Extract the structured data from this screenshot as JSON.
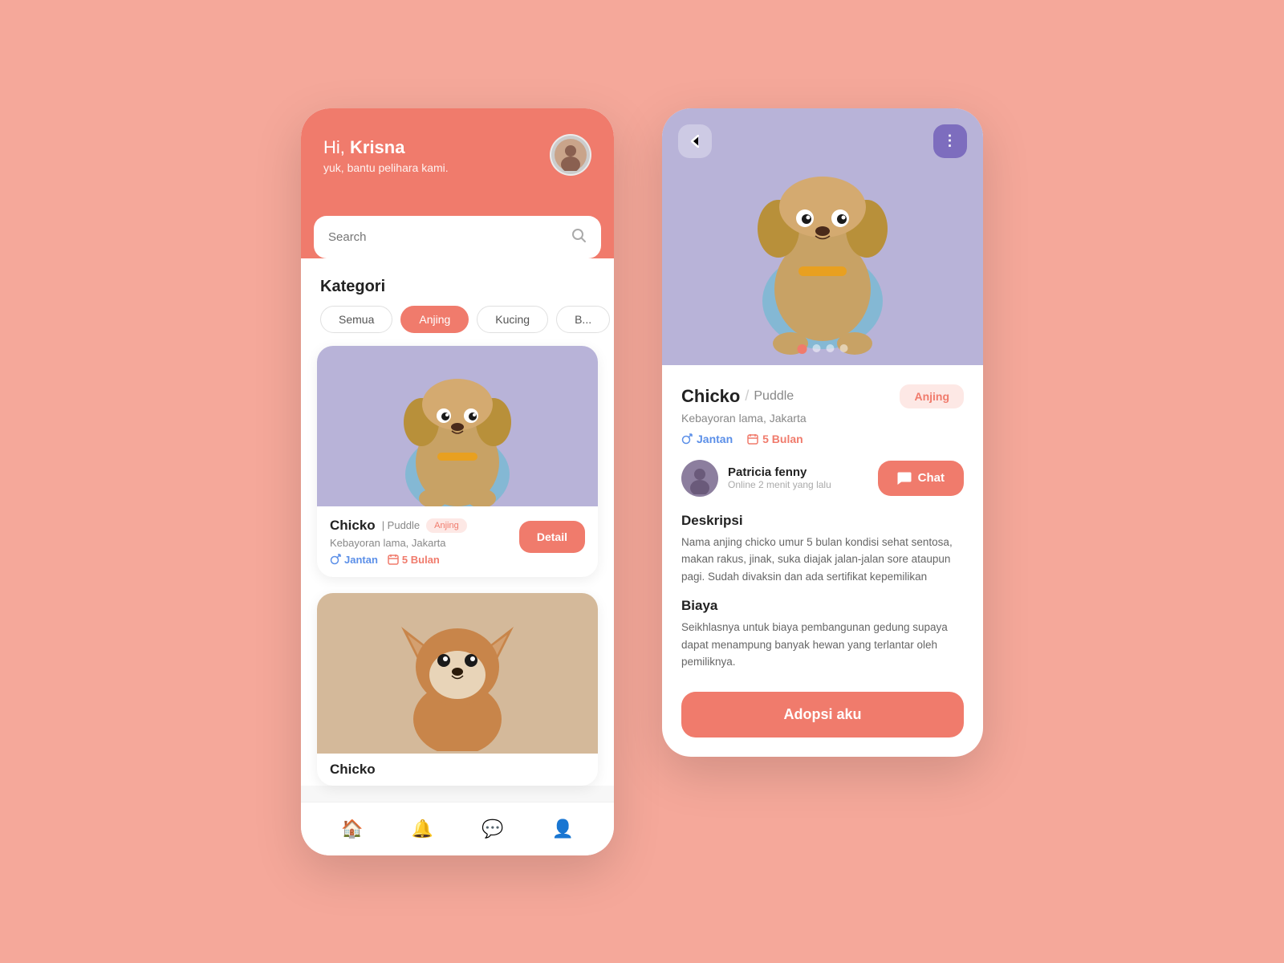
{
  "screen1": {
    "header": {
      "greeting": "Hi, ",
      "user_name": "Krisna",
      "subtitle": "yuk, bantu pelihara kami."
    },
    "search": {
      "placeholder": "Search"
    },
    "kategori": {
      "title": "Kategori",
      "tabs": [
        {
          "label": "Semua",
          "active": false
        },
        {
          "label": "Anjing",
          "active": true
        },
        {
          "label": "Kucing",
          "active": false
        },
        {
          "label": "B...",
          "active": false
        }
      ]
    },
    "pets": [
      {
        "name": "Chicko",
        "separator": "|",
        "breed": "Puddle",
        "badge": "Anjing",
        "location": "Kebayoran lama, Jakarta",
        "gender": "Jantan",
        "age": "5 Bulan",
        "detail_btn": "Detail"
      },
      {
        "name": "Chicko",
        "location": "..."
      }
    ]
  },
  "screen2": {
    "back_btn": "‹",
    "more_btn": "⋮",
    "pet": {
      "name": "Chicko",
      "breed": "Puddle",
      "badge": "Anjing",
      "location": "Kebayoran lama, Jakarta",
      "gender": "Jantan",
      "age": "5 Bulan"
    },
    "owner": {
      "name": "Patricia fenny",
      "status": "Online 2 menit yang lalu"
    },
    "chat_btn": "Chat",
    "deskripsi": {
      "title": "Deskripsi",
      "text": "Nama anjing chicko umur 5 bulan kondisi sehat sentosa, makan rakus, jinak, suka diajak jalan-jalan sore ataupun pagi. Sudah divaksin dan ada sertifikat kepemilikan"
    },
    "biaya": {
      "title": "Biaya",
      "text": "Seikhlasnya untuk biaya pembangunan gedung supaya dapat menampung banyak hewan yang terlantar oleh pemiliknya."
    },
    "adopt_btn": "Adopsi aku"
  },
  "nav": {
    "items": [
      {
        "icon": "🏠",
        "label": "home",
        "active": true
      },
      {
        "icon": "🔔",
        "label": "notifications",
        "active": false
      },
      {
        "icon": "💬",
        "label": "chat",
        "active": false
      },
      {
        "icon": "👤",
        "label": "profile",
        "active": false
      }
    ]
  }
}
